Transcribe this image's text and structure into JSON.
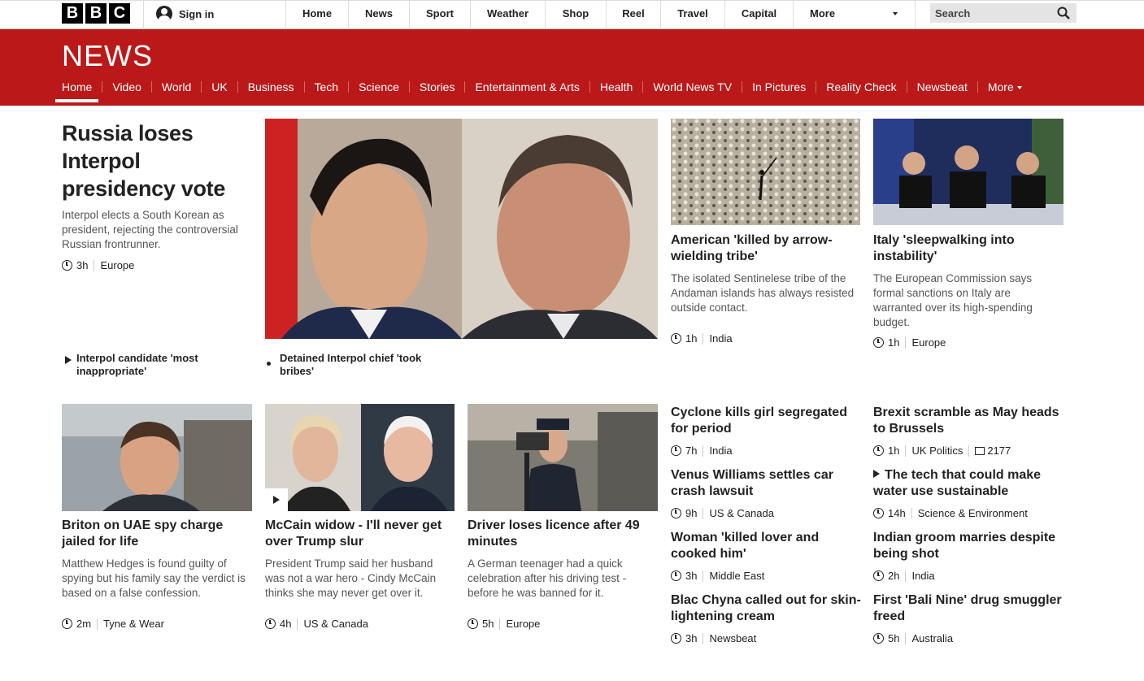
{
  "logo": [
    "B",
    "B",
    "C"
  ],
  "signin": {
    "label": "Sign in"
  },
  "topnav": [
    {
      "label": "Home"
    },
    {
      "label": "News"
    },
    {
      "label": "Sport"
    },
    {
      "label": "Weather"
    },
    {
      "label": "Shop"
    },
    {
      "label": "Reel"
    },
    {
      "label": "Travel"
    },
    {
      "label": "Capital"
    },
    {
      "label": "More"
    }
  ],
  "search": {
    "placeholder": "Search"
  },
  "news": {
    "wordmark": "NEWS",
    "subnav": [
      {
        "label": "Home"
      },
      {
        "label": "Video"
      },
      {
        "label": "World"
      },
      {
        "label": "UK"
      },
      {
        "label": "Business"
      },
      {
        "label": "Tech"
      },
      {
        "label": "Science"
      },
      {
        "label": "Stories"
      },
      {
        "label": "Entertainment & Arts"
      },
      {
        "label": "Health"
      },
      {
        "label": "World News TV"
      },
      {
        "label": "In Pictures"
      },
      {
        "label": "Reality Check"
      },
      {
        "label": "Newsbeat"
      },
      {
        "label": "More"
      }
    ]
  },
  "lead": {
    "title": "Russia loses Interpol presidency vote",
    "summary": "Interpol elects a South Korean as president, rejecting the controversial Russian frontrunner.",
    "time": "3h",
    "section": "Europe",
    "related": [
      {
        "icon": "play",
        "text": "Interpol candidate 'most inappropriate'"
      },
      {
        "icon": "bullet",
        "text": "Detained Interpol chief 'took bribes'"
      }
    ]
  },
  "top_stories": [
    {
      "headline": "American 'killed by arrow-wielding tribe'",
      "summary": "The isolated Sentinelese tribe of the Andaman islands has always resisted outside contact.",
      "time": "1h",
      "section": "India"
    },
    {
      "headline": "Italy 'sleepwalking into instability'",
      "summary": "The European Commission says formal sanctions on Italy are warranted over its high-spending budget.",
      "time": "1h",
      "section": "Europe"
    }
  ],
  "second_row": [
    {
      "headline": "Briton on UAE spy charge jailed for life",
      "summary": "Matthew Hedges is found guilty of spying but his family say the verdict is based on a false confession.",
      "time": "2m",
      "section": "Tyne & Wear"
    },
    {
      "headline": "McCain widow - I'll never get over Trump slur",
      "summary": "President Trump said her husband was not a war hero - Cindy McCain thinks she may never get over it.",
      "time": "4h",
      "section": "US & Canada"
    },
    {
      "headline": "Driver loses licence after 49 minutes",
      "summary": "A German teenager had a quick celebration after his driving test - before he was banned for it.",
      "time": "5h",
      "section": "Europe"
    }
  ],
  "list_left": [
    {
      "headline": "Cyclone kills girl segregated for period",
      "time": "7h",
      "section": "India"
    },
    {
      "headline": "Venus Williams settles car crash lawsuit",
      "time": "9h",
      "section": "US & Canada"
    },
    {
      "headline": "Woman 'killed lover and cooked him'",
      "time": "3h",
      "section": "Middle East"
    },
    {
      "headline": "Blac Chyna called out for skin-lightening cream",
      "time": "3h",
      "section": "Newsbeat"
    }
  ],
  "list_right": [
    {
      "headline": "Brexit scramble as May heads to Brussels",
      "time": "1h",
      "section": "UK Politics",
      "comments": "2177"
    },
    {
      "headline": "The tech that could make water use sustainable",
      "time": "14h",
      "section": "Science & Environment"
    },
    {
      "headline": "Indian groom marries despite being shot",
      "time": "2h",
      "section": "India"
    },
    {
      "headline": "First 'Bali Nine' drug smuggler freed",
      "time": "5h",
      "section": "Australia"
    }
  ],
  "colors": {
    "brand_red": "#bb1919",
    "text": "#222222",
    "summary": "#555555"
  }
}
